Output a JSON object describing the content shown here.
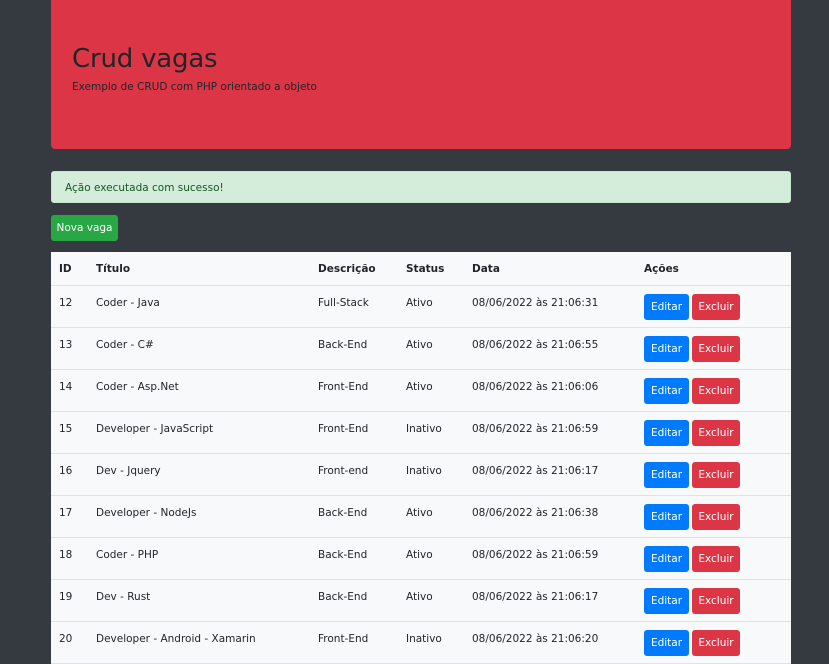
{
  "header": {
    "title": "Crud vagas",
    "subtitle": "Exemplo de CRUD com PHP orientado a objeto"
  },
  "alert": {
    "message": "Ação executada com sucesso!"
  },
  "toolbar": {
    "new_label": "Nova vaga"
  },
  "table": {
    "columns": [
      "ID",
      "Título",
      "Descrição",
      "Status",
      "Data",
      "Ações"
    ],
    "edit_label": "Editar",
    "delete_label": "Excluir",
    "rows": [
      {
        "id": "12",
        "title": "Coder - Java",
        "description": "Full-Stack",
        "status": "Ativo",
        "date": "08/06/2022 às 21:06:31"
      },
      {
        "id": "13",
        "title": "Coder - C#",
        "description": "Back-End",
        "status": "Ativo",
        "date": "08/06/2022 às 21:06:55"
      },
      {
        "id": "14",
        "title": "Coder - Asp.Net",
        "description": "Front-End",
        "status": "Ativo",
        "date": "08/06/2022 às 21:06:06"
      },
      {
        "id": "15",
        "title": "Developer - JavaScript",
        "description": "Front-End",
        "status": "Inativo",
        "date": "08/06/2022 às 21:06:59"
      },
      {
        "id": "16",
        "title": "Dev - Jquery",
        "description": "Front-end",
        "status": "Inativo",
        "date": "08/06/2022 às 21:06:17"
      },
      {
        "id": "17",
        "title": "Developer - NodeJs",
        "description": "Back-End",
        "status": "Ativo",
        "date": "08/06/2022 às 21:06:38"
      },
      {
        "id": "18",
        "title": "Coder - PHP",
        "description": "Back-End",
        "status": "Ativo",
        "date": "08/06/2022 às 21:06:59"
      },
      {
        "id": "19",
        "title": "Dev - Rust",
        "description": "Back-End",
        "status": "Ativo",
        "date": "08/06/2022 às 21:06:17"
      },
      {
        "id": "20",
        "title": "Developer - Android - Xamarin",
        "description": "Front-End",
        "status": "Inativo",
        "date": "08/06/2022 às 21:06:20"
      }
    ]
  },
  "colors": {
    "background": "#343a40",
    "header": "#dc3545",
    "success": "#28a745",
    "primary": "#007bff",
    "danger": "#dc3545"
  }
}
